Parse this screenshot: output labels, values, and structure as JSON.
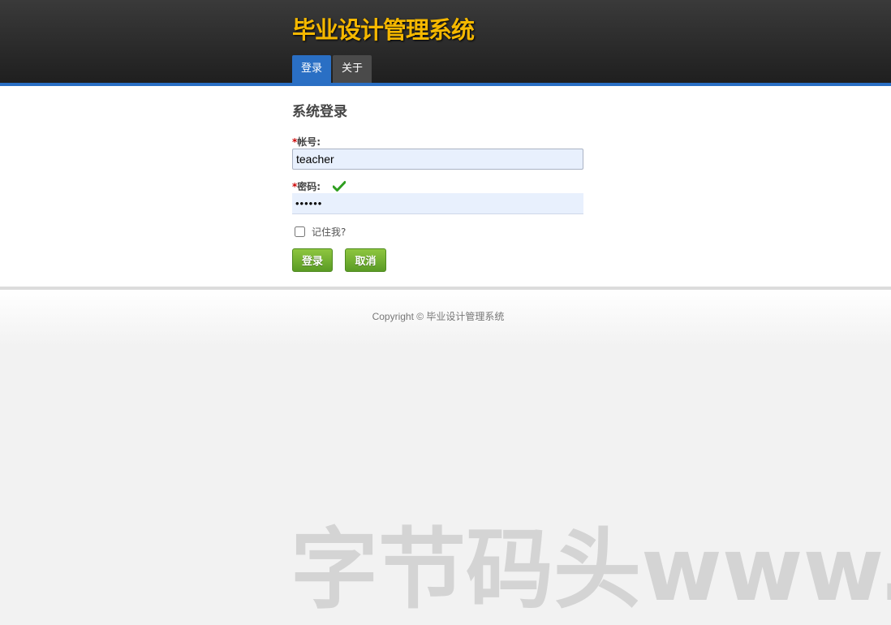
{
  "header": {
    "site_title": "毕业设计管理系统",
    "nav": [
      {
        "label": "登录",
        "active": true
      },
      {
        "label": "关于",
        "active": false
      }
    ],
    "accent_color": "#2a6fc4",
    "title_color": "#f5b800"
  },
  "login_form": {
    "title": "系统登录",
    "required_mark": "*",
    "account_label": "帐号:",
    "account_value": "teacher",
    "password_label": "密码:",
    "password_value": "••••••",
    "password_valid_icon": "check-icon",
    "remember_label": "记住我?",
    "remember_checked": false,
    "login_button": "登录",
    "cancel_button": "取消",
    "button_color": "#6aab2f"
  },
  "footer": {
    "copyright": "Copyright © 毕业设计管理系统"
  },
  "watermark": {
    "text": "字节码头www."
  }
}
